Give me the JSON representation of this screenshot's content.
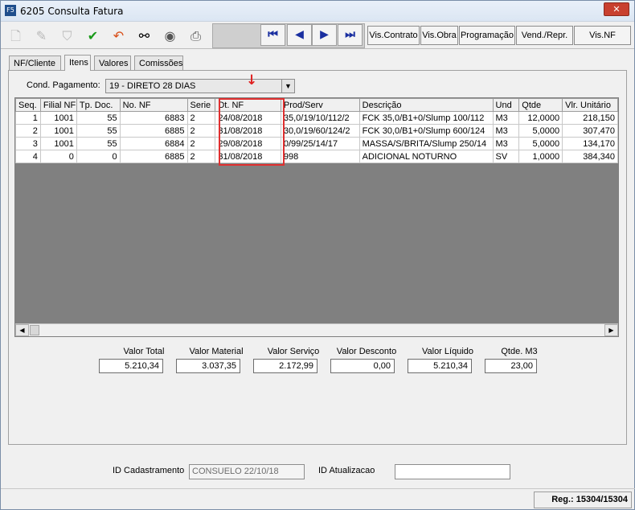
{
  "window": {
    "title": "6205 Consulta Fatura",
    "icon_text": "F5",
    "close_label": "✕"
  },
  "toolbar": {
    "buttons": [
      "Vis.Contrato",
      "Vis.Obra",
      "Programação",
      "Vend./Repr.",
      "Vis.NF"
    ]
  },
  "tabs": [
    "NF/Cliente",
    "Itens",
    "Valores",
    "Comissões"
  ],
  "cond_pagamento": {
    "label": "Cond. Pagamento:",
    "value": "19 - DIRETO 28 DIAS"
  },
  "grid": {
    "columns": [
      "Seq.",
      "Filial NF",
      "Tp. Doc.",
      "No. NF",
      "Serie",
      "Dt. NF",
      "Prod/Serv",
      "Descrição",
      "Und",
      "Qtde",
      "Vlr. Unitário"
    ],
    "rows": [
      [
        "1",
        "1001",
        "55",
        "6883",
        "2",
        "24/08/2018",
        "35,0/19/10/112/2",
        "FCK 35,0/B1+0/Slump 100/112",
        "M3",
        "12,0000",
        "218,150"
      ],
      [
        "2",
        "1001",
        "55",
        "6885",
        "2",
        "31/08/2018",
        "30,0/19/60/124/2",
        "FCK 30,0/B1+0/Slump 600/124",
        "M3",
        "5,0000",
        "307,470"
      ],
      [
        "3",
        "1001",
        "55",
        "6884",
        "2",
        "29/08/2018",
        "0/99/25/14/17",
        "MASSA/S/BRITA/Slump 250/14",
        "M3",
        "5,0000",
        "134,170"
      ],
      [
        "4",
        "0",
        "0",
        "6885",
        "2",
        "31/08/2018",
        "998",
        "ADICIONAL NOTURNO",
        "SV",
        "1,0000",
        "384,340"
      ]
    ]
  },
  "totals": [
    {
      "label": "Valor Total",
      "value": "5.210,34"
    },
    {
      "label": "Valor Material",
      "value": "3.037,35"
    },
    {
      "label": "Valor Serviço",
      "value": "2.172,99"
    },
    {
      "label": "Valor Desconto",
      "value": "0,00"
    },
    {
      "label": "Valor Líquido",
      "value": "5.210,34"
    },
    {
      "label": "Qtde. M3",
      "value": "23,00"
    }
  ],
  "footer": {
    "id_cadastramento_label": "ID Cadastramento",
    "id_cadastramento_value": "CONSUELO 22/10/18",
    "id_atualizacao_label": "ID Atualizacao",
    "id_atualizacao_value": "",
    "status": "Reg.: 15304/15304"
  },
  "icons": [
    "new-doc-icon",
    "edit-icon",
    "shield-icon",
    "check-icon",
    "undo-icon",
    "binoculars-icon",
    "disk-icon",
    "print-icon",
    "first-record-icon",
    "prev-record-icon",
    "next-record-icon",
    "last-record-icon"
  ]
}
